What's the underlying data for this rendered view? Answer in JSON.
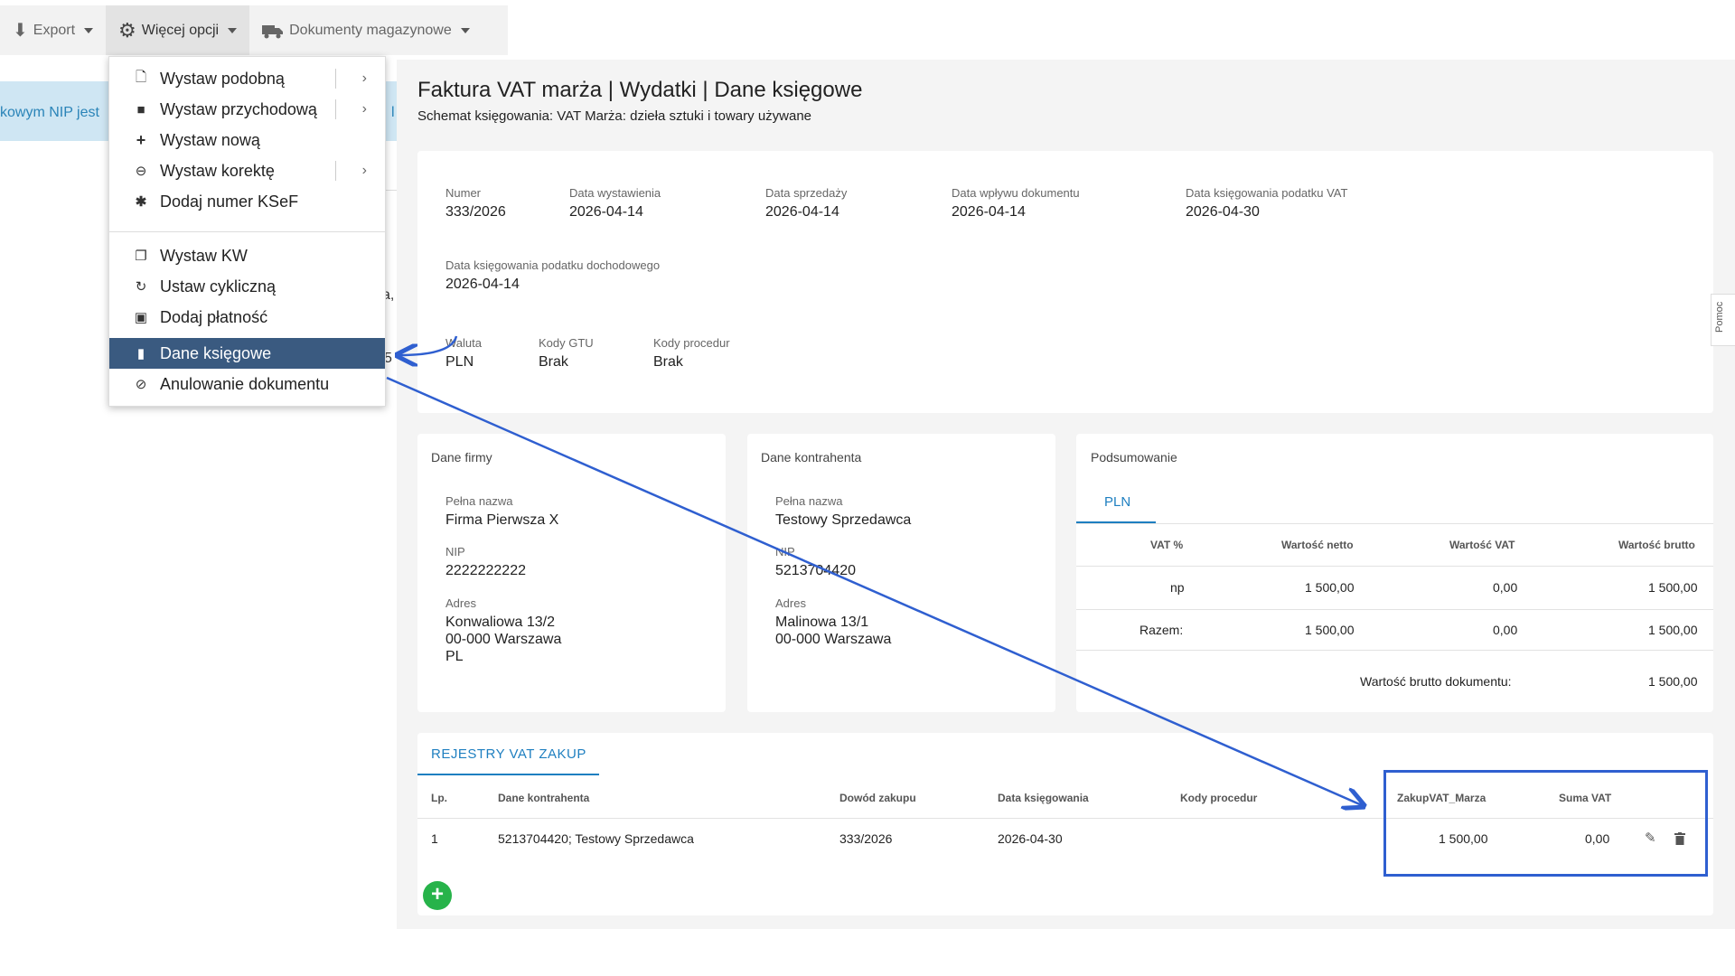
{
  "toolbar": {
    "export_label": "Export",
    "more_options_label": "Więcej opcji",
    "warehouse_docs_label": "Dokumenty magazynowe"
  },
  "background": {
    "banner_text": "kowym NIP jest",
    "banner_frag": "l",
    "frag_a": "a,",
    "frag_5": "5"
  },
  "menu": {
    "items": [
      {
        "label": "Wystaw podobną",
        "icon": "file-icon"
      },
      {
        "label": "Wystaw przychodową",
        "icon": "file-filled-icon"
      },
      {
        "label": "Wystaw nową",
        "icon": "plus-icon"
      },
      {
        "label": "Wystaw korektę",
        "icon": "minus-circle-icon"
      },
      {
        "label": "Dodaj numer KSeF",
        "icon": "asterisk-icon"
      },
      {
        "label": "Wystaw KW",
        "icon": "copy-icon"
      },
      {
        "label": "Ustaw cykliczną",
        "icon": "refresh-icon"
      },
      {
        "label": "Dodaj płatność",
        "icon": "money-icon"
      },
      {
        "label": "Dane księgowe",
        "icon": "book-icon"
      },
      {
        "label": "Anulowanie dokumentu",
        "icon": "ban-icon"
      }
    ]
  },
  "page": {
    "title": "Faktura VAT marża | Wydatki | Dane księgowe",
    "subtitle": "Schemat księgowania: VAT Marża: dzieła sztuki i towary używane"
  },
  "details": {
    "numer_label": "Numer",
    "numer": "333/2026",
    "data_wyst_label": "Data wystawienia",
    "data_wyst": "2026-04-14",
    "data_sprz_label": "Data sprzedaży",
    "data_sprz": "2026-04-14",
    "data_wplywu_label": "Data wpływu dokumentu",
    "data_wplywu": "2026-04-14",
    "data_ksieg_vat_label": "Data księgowania podatku VAT",
    "data_ksieg_vat": "2026-04-30",
    "data_ksieg_doch_label": "Data księgowania podatku dochodowego",
    "data_ksieg_doch": "2026-04-14",
    "waluta_label": "Waluta",
    "waluta": "PLN",
    "gtu_label": "Kody GTU",
    "gtu": "Brak",
    "procedur_label": "Kody procedur",
    "procedur": "Brak"
  },
  "firma": {
    "title": "Dane firmy",
    "nazwa_label": "Pełna nazwa",
    "nazwa": "Firma Pierwsza X",
    "nip_label": "NIP",
    "nip": "2222222222",
    "adres_label": "Adres",
    "adres1": "Konwaliowa 13/2",
    "adres2": "00-000 Warszawa",
    "adres3": "PL"
  },
  "kontrahent": {
    "title": "Dane kontrahenta",
    "nazwa_label": "Pełna nazwa",
    "nazwa": "Testowy Sprzedawca",
    "nip_label": "NIP",
    "nip": "5213704420",
    "adres_label": "Adres",
    "adres1": "Malinowa 13/1",
    "adres2": "00-000 Warszawa"
  },
  "podsumowanie": {
    "title": "Podsumowanie",
    "tab": "PLN",
    "headers": [
      "VAT %",
      "Wartość netto",
      "Wartość VAT",
      "Wartość brutto"
    ],
    "row1": [
      "np",
      "1 500,00",
      "0,00",
      "1 500,00"
    ],
    "row2": [
      "Razem:",
      "1 500,00",
      "0,00",
      "1 500,00"
    ],
    "total_label": "Wartość brutto dokumentu:",
    "total_value": "1 500,00"
  },
  "rejestry": {
    "tab": "REJESTRY VAT ZAKUP",
    "headers": [
      "Lp.",
      "Dane kontrahenta",
      "Dowód zakupu",
      "Data księgowania",
      "Kody procedur",
      "ZakupVAT_Marza",
      "Suma VAT"
    ],
    "row": [
      "1",
      "5213704420; Testowy Sprzedawca",
      "333/2026",
      "2026-04-30",
      "",
      "1 500,00",
      "0,00"
    ]
  },
  "help": {
    "label": "Pomoc"
  },
  "colors": {
    "accent": "#1e7fc0",
    "menu_active": "#3a5a80",
    "highlight": "#2f5fd0",
    "add": "#27b34a"
  }
}
